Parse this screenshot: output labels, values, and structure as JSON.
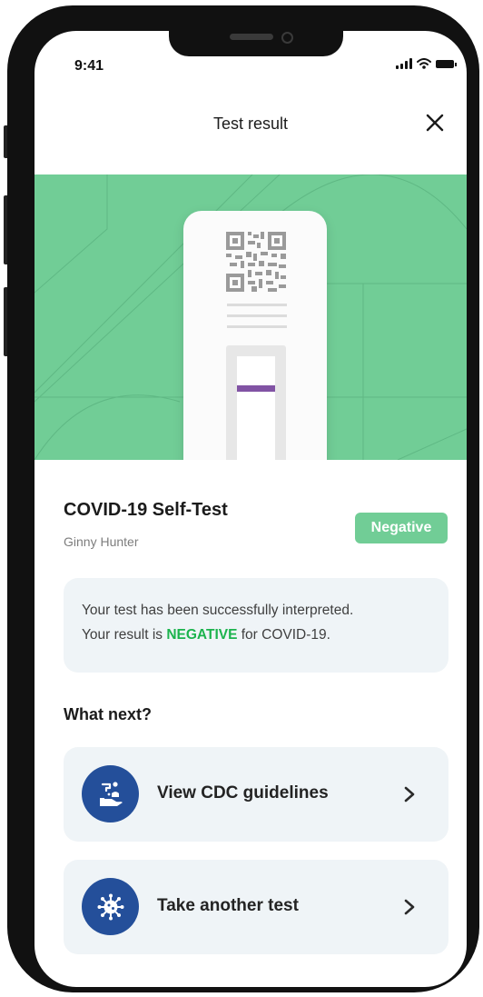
{
  "status_bar": {
    "time": "9:41",
    "icons": [
      "signal-icon",
      "wifi-icon",
      "battery-icon"
    ]
  },
  "header": {
    "title": "Test result",
    "close_icon": "close-icon"
  },
  "hero": {
    "background_color": "#71cd96",
    "illustration": "test-cassette-illustration",
    "result_line_color": "#8153a4"
  },
  "test": {
    "title": "COVID-19 Self-Test",
    "user_name": "Ginny Hunter",
    "badge": "Negative",
    "badge_color": "#71cd96"
  },
  "info": {
    "line1": "Your test has been successfully  interpreted.",
    "line2_prefix": "Your result is ",
    "line2_highlight": "NEGATIVE",
    "line2_suffix": " for COVID-19.",
    "highlight_color": "#1bb34d"
  },
  "next": {
    "title": "What next?",
    "actions": [
      {
        "label": "View CDC guidelines",
        "icon": "hand-wash-icon",
        "chevron": "chevron-right-icon"
      },
      {
        "label": "Take another test",
        "icon": "virus-icon",
        "chevron": "chevron-right-icon"
      }
    ],
    "icon_bg_color": "#244f9a"
  }
}
